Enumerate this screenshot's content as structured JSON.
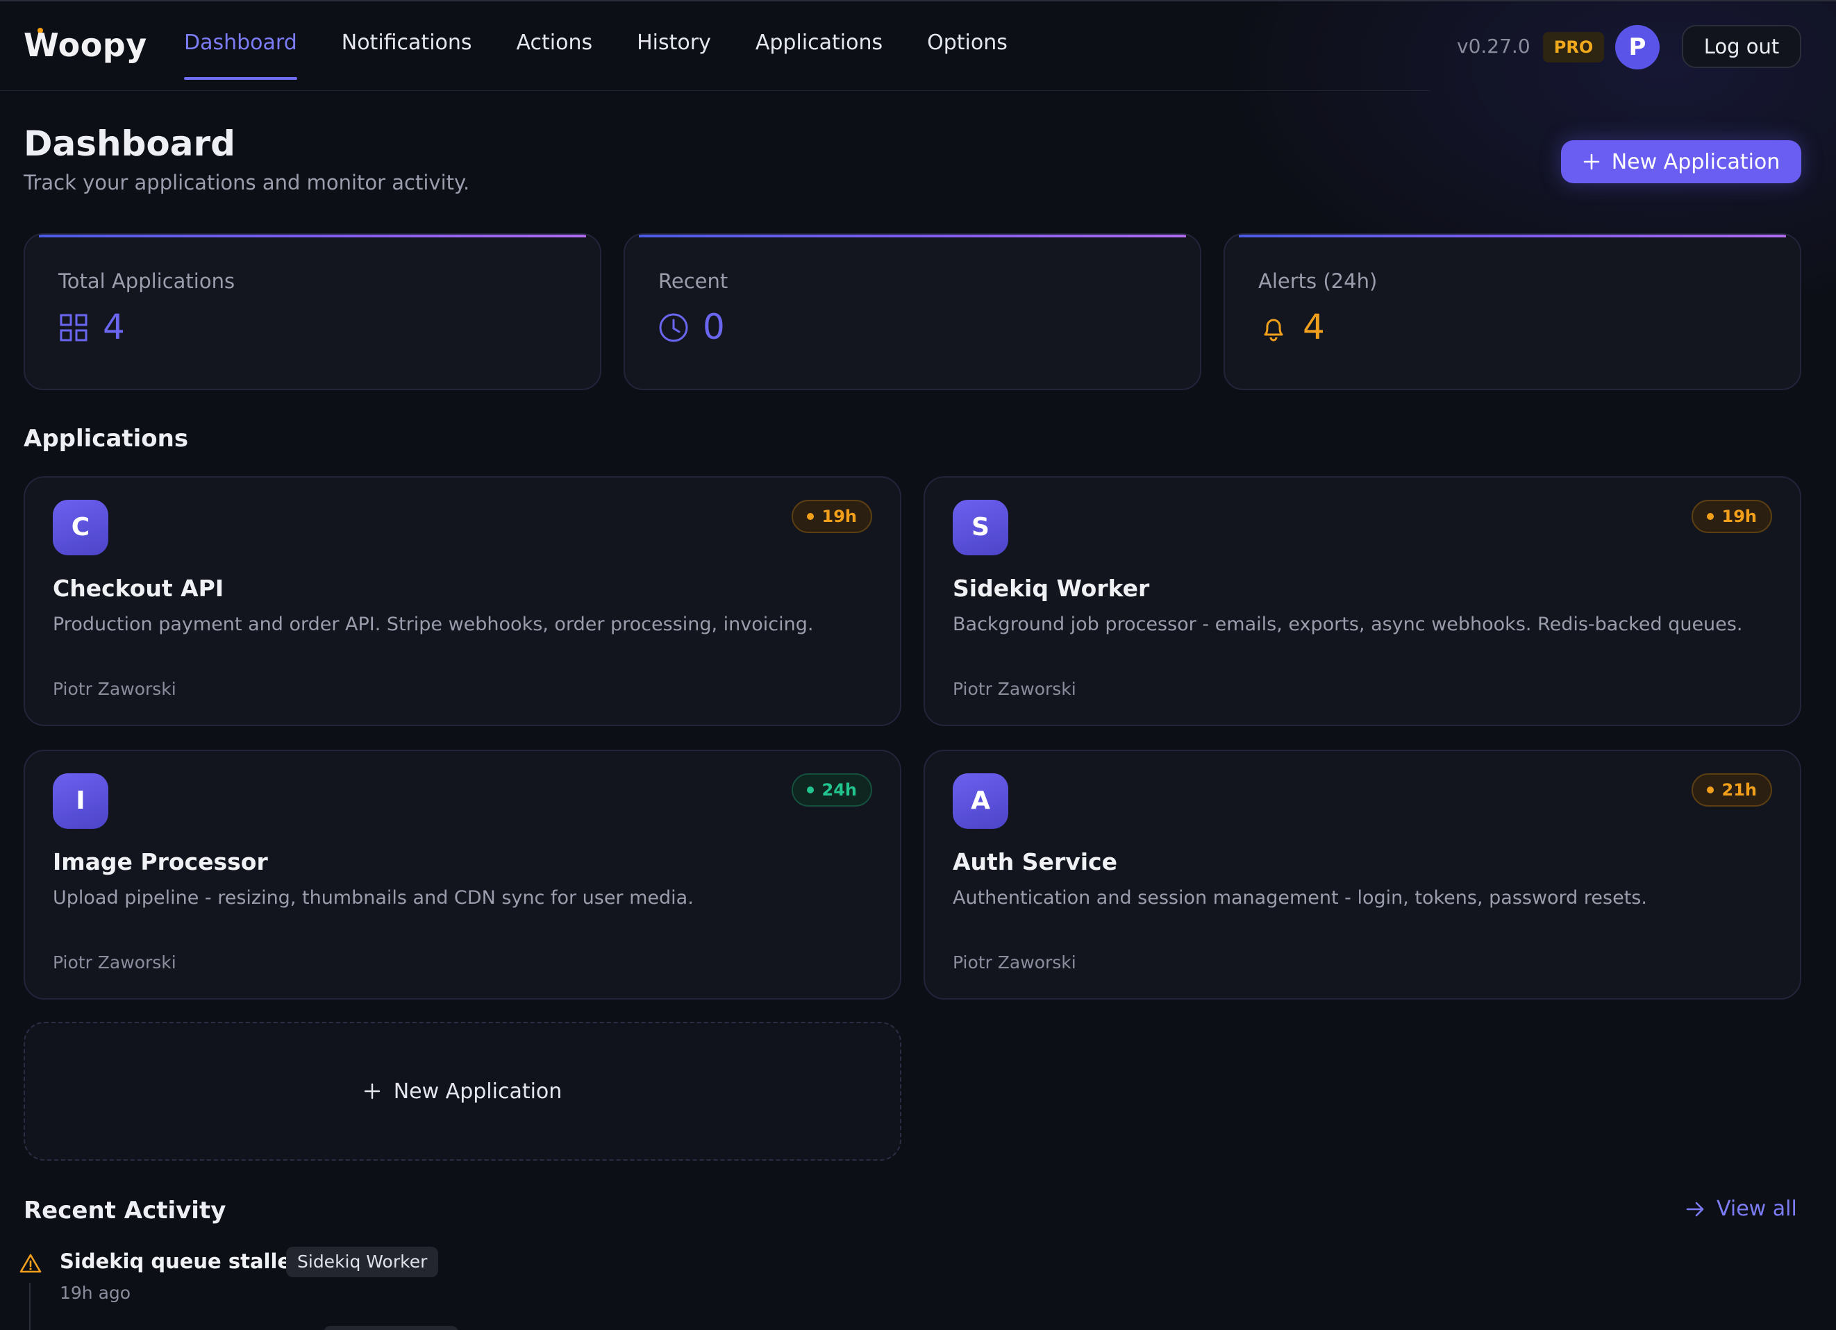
{
  "nav": {
    "logo": "Woopy",
    "links": [
      {
        "label": "Dashboard",
        "active": true
      },
      {
        "label": "Notifications",
        "active": false
      },
      {
        "label": "Actions",
        "active": false
      },
      {
        "label": "History",
        "active": false
      },
      {
        "label": "Applications",
        "active": false
      },
      {
        "label": "Options",
        "active": false
      }
    ],
    "version": "v0.27.0",
    "plan_badge": "PRO",
    "user_initial": "P",
    "logout_label": "Log out"
  },
  "header": {
    "title": "Dashboard",
    "subtitle": "Track your applications and monitor activity.",
    "new_app_label": "New Application"
  },
  "stats": [
    {
      "label": "Total Applications",
      "value": "4",
      "icon": "grid-icon",
      "color": "#6a66f0"
    },
    {
      "label": "Recent",
      "value": "0",
      "icon": "clock-icon",
      "color": "#6a66f0"
    },
    {
      "label": "Alerts (24h)",
      "value": "4",
      "icon": "bell-icon",
      "color": "#f0a01c"
    }
  ],
  "applications": {
    "title": "Applications",
    "items": [
      {
        "initial": "C",
        "name": "Checkout API",
        "description": "Production payment and order API. Stripe webhooks, order processing, invoicing.",
        "owner": "Piotr Zaworski",
        "badge": "19h",
        "badge_color": "orange"
      },
      {
        "initial": "S",
        "name": "Sidekiq Worker",
        "description": "Background job processor - emails, exports, async webhooks. Redis-backed queues.",
        "owner": "Piotr Zaworski",
        "badge": "19h",
        "badge_color": "orange"
      },
      {
        "initial": "I",
        "name": "Image Processor",
        "description": "Upload pipeline - resizing, thumbnails and CDN sync for user media.",
        "owner": "Piotr Zaworski",
        "badge": "24h",
        "badge_color": "green"
      },
      {
        "initial": "A",
        "name": "Auth Service",
        "description": "Authentication and session management - login, tokens, password resets.",
        "owner": "Piotr Zaworski",
        "badge": "21h",
        "badge_color": "orange"
      }
    ],
    "new_card_label": "New Application"
  },
  "activity": {
    "title": "Recent Activity",
    "view_all_label": "View all",
    "items": [
      {
        "title": "Sidekiq queue stalled",
        "app": "Sidekiq Worker",
        "time": "19h ago",
        "icon": "warning-icon"
      }
    ]
  }
}
